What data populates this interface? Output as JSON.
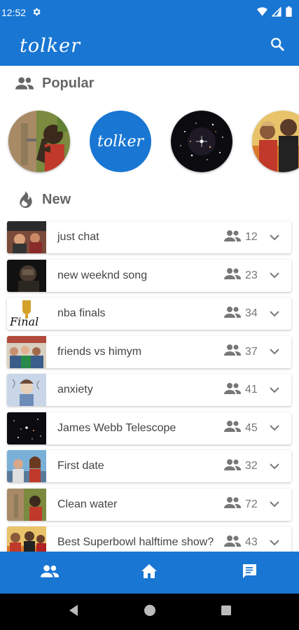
{
  "status_bar": {
    "time": "12:52",
    "icons": [
      "gear-icon",
      "wifi-icon",
      "signal-icon",
      "battery-icon"
    ]
  },
  "app_bar": {
    "logo_text": "tolker",
    "actions": [
      "search-icon"
    ]
  },
  "popular": {
    "header": "Popular",
    "icon": "people-icon",
    "items": [
      {
        "image": "boy-drinking-water",
        "kind": "photo"
      },
      {
        "image": "tolker-logo",
        "kind": "logo",
        "text": "tolker"
      },
      {
        "image": "galaxy-deep-field",
        "kind": "photo"
      },
      {
        "image": "superbowl-performers",
        "kind": "photo"
      }
    ]
  },
  "new": {
    "header": "New",
    "icon": "fire-icon",
    "rows": [
      {
        "title": "just chat",
        "count": "12",
        "thumb": "chat-photo"
      },
      {
        "title": "new weeknd song",
        "count": "23",
        "thumb": "weeknd-photo"
      },
      {
        "title": "nba finals",
        "count": "34",
        "thumb": "nba-finals-logo"
      },
      {
        "title": "friends vs himym",
        "count": "37",
        "thumb": "friends-cast"
      },
      {
        "title": "anxiety",
        "count": "41",
        "thumb": "anxiety-illustration"
      },
      {
        "title": "James Webb Telescope",
        "count": "45",
        "thumb": "galaxy-deep-field"
      },
      {
        "title": "First date",
        "count": "32",
        "thumb": "couple-date"
      },
      {
        "title": "Clean water",
        "count": "72",
        "thumb": "boy-drinking-water"
      },
      {
        "title": "Best Superbowl halftime show?",
        "count": "43",
        "thumb": "superbowl-performers"
      }
    ]
  },
  "bottom_nav": [
    "people-icon",
    "home-icon",
    "chat-icon"
  ],
  "system_nav": [
    "back-icon",
    "home-circle-icon",
    "recents-icon"
  ],
  "colors": {
    "primary": "#1976d2",
    "header_text": "#666666",
    "row_text": "#444444",
    "count_text": "#777777"
  }
}
